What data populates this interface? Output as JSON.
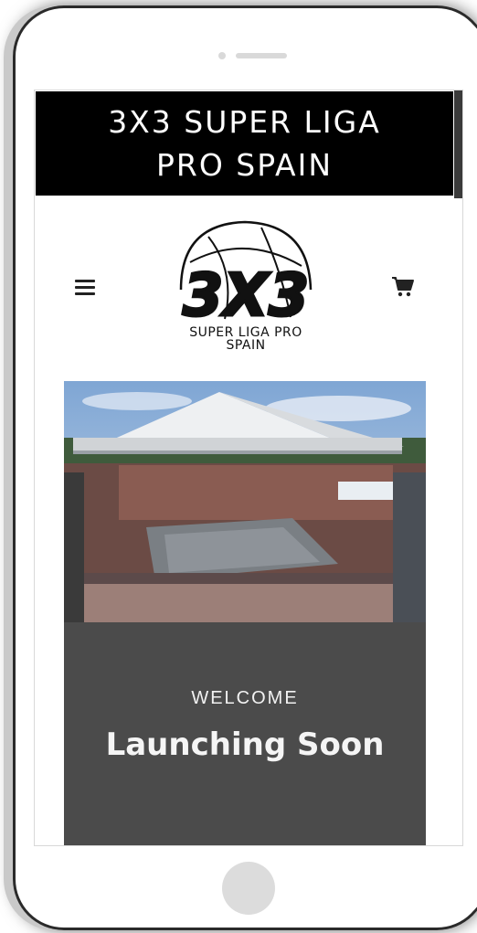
{
  "banner": {
    "title": "3X3 SUPER LIGA PRO SPAIN"
  },
  "header": {
    "menu_icon": "hamburger-menu-icon",
    "cart_icon": "shopping-cart-icon",
    "logo": {
      "mark": "3X3",
      "caption_line1": "SUPER LIGA PRO",
      "caption_line2": "SPAIN"
    }
  },
  "hero": {
    "image": "outdoor-basketball-court-crowd"
  },
  "welcome": {
    "label": "WELCOME",
    "title": "Launching Soon"
  },
  "colors": {
    "banner_bg": "#000000",
    "panel_bg": "#4b4b4b",
    "text_light": "#f5f5f5"
  }
}
